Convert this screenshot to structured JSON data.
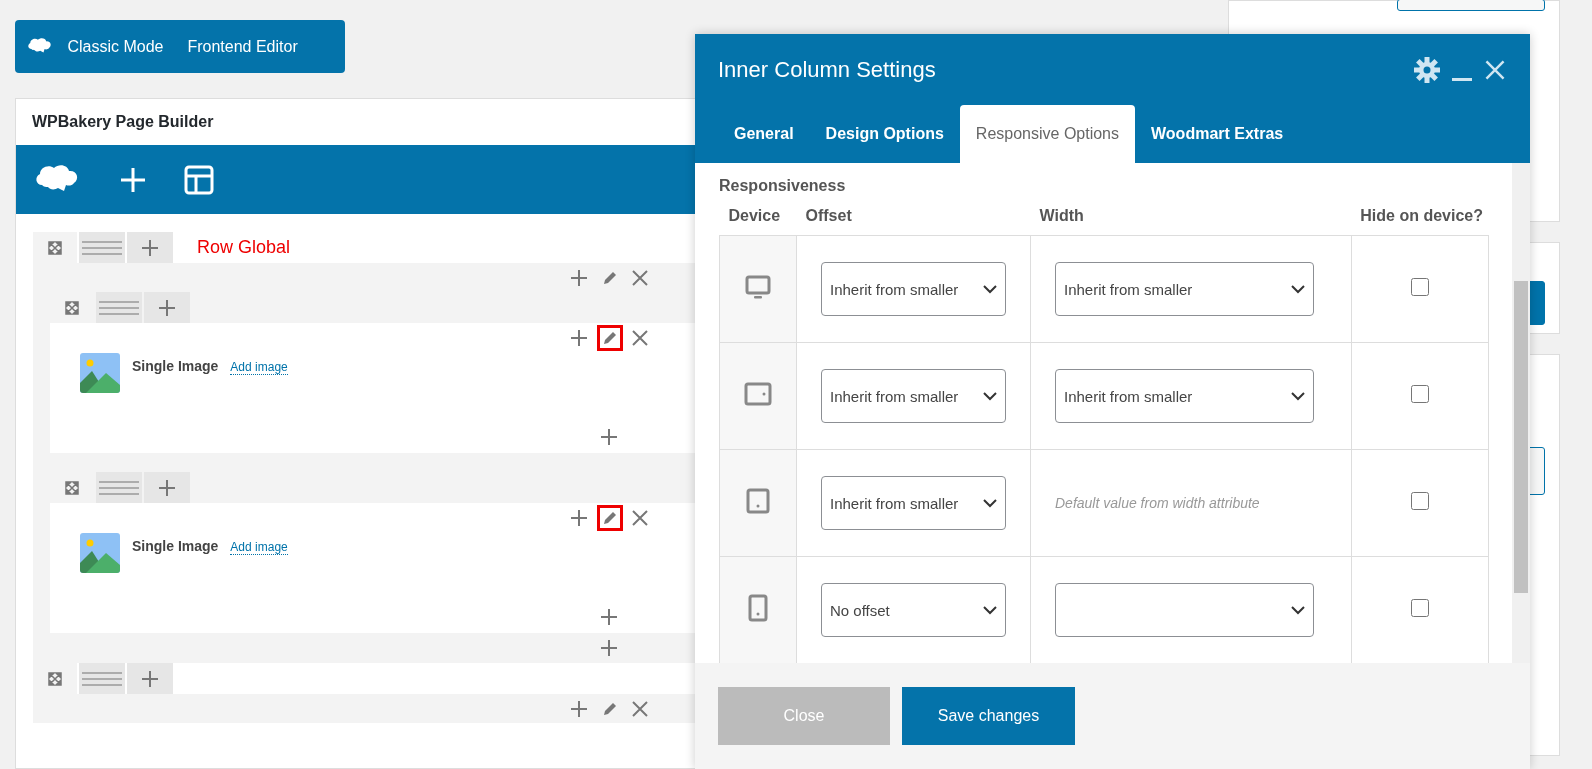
{
  "editor_modes": [
    {
      "label": "Classic Mode"
    },
    {
      "label": "Frontend Editor"
    }
  ],
  "builder": {
    "title": "WPBakery Page Builder"
  },
  "rows": [
    {
      "label": "Row Global",
      "inner_rows": [
        {
          "elements": [
            {
              "name": "Single Image",
              "action": "Add image"
            }
          ],
          "edit_highlighted": true
        },
        {
          "elements": [
            {
              "name": "Single Image",
              "action": "Add image"
            }
          ],
          "edit_highlighted": true
        }
      ]
    },
    {
      "inner_rows": []
    }
  ],
  "modal": {
    "title": "Inner Column Settings",
    "tabs": [
      {
        "label": "General",
        "selected": false
      },
      {
        "label": "Design Options",
        "selected": false
      },
      {
        "label": "Responsive Options",
        "selected": true
      },
      {
        "label": "Woodmart Extras",
        "selected": false
      }
    ],
    "section": "Responsiveness",
    "columns": [
      "Device",
      "Offset",
      "Width",
      "Hide on device?"
    ],
    "rows": [
      {
        "kind": "desktop",
        "offset": "Inherit from smaller",
        "width": {
          "kind": "select",
          "value": "Inherit from smaller"
        },
        "hidden": false
      },
      {
        "kind": "tablet-landscape",
        "offset": "Inherit from smaller",
        "width": {
          "kind": "select",
          "value": "Inherit from smaller"
        },
        "hidden": false
      },
      {
        "kind": "tablet-portrait",
        "offset": "Inherit from smaller",
        "width": {
          "kind": "note",
          "value": "Default value from width attribute"
        },
        "hidden": false
      },
      {
        "kind": "phone",
        "offset": "No offset",
        "width": {
          "kind": "select"
        },
        "hidden": false
      }
    ],
    "buttons": [
      {
        "label": "Close",
        "disabled": true
      },
      {
        "label": "Save changes",
        "disabled": false
      }
    ]
  }
}
